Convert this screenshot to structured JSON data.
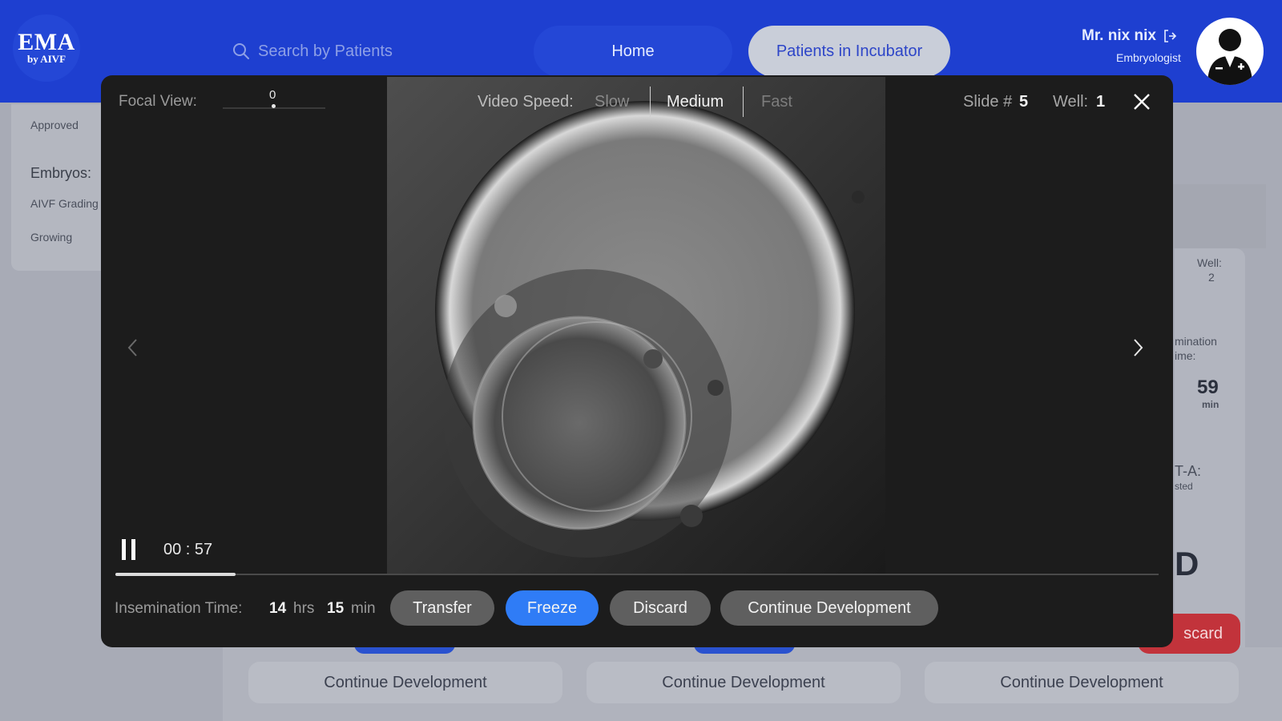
{
  "colors": {
    "header_bg": "#1e3fd0",
    "primary_blue": "#2f7cf6",
    "modal_bg": "#1c1c1c",
    "danger_red": "#c2333b"
  },
  "header": {
    "logo_main": "EMA",
    "logo_sub": "by AIVF",
    "search_placeholder": "Search by Patients",
    "search_icon": "search-icon",
    "nav_home": "Home",
    "nav_incubator": "Patients in Incubator",
    "user_name": "Mr. nix nix",
    "user_role": "Embryologist",
    "logout_icon": "logout-icon",
    "avatar_icon": "doctor-avatar-icon"
  },
  "background": {
    "sidebar": {
      "approved": "Approved",
      "embryos_label": "Embryos:",
      "aivf_grading": "AIVF Grading",
      "growing": "Growing"
    },
    "right_card": {
      "well_label": "Well:",
      "well_value": "2",
      "insemination_partial": "mination",
      "time_partial": "ime:",
      "minutes_value": "59",
      "minutes_unit": "min",
      "pgt_partial": "T-A:",
      "pgt_status_partial": "sted",
      "grade_partial": "D",
      "discard_partial": "scard"
    },
    "continue_buttons": [
      "Continue Development",
      "Continue Development",
      "Continue Development"
    ]
  },
  "modal": {
    "focal_view_label": "Focal View:",
    "focal_view_value": "0",
    "video_speed_label": "Video Speed:",
    "speed_options": [
      "Slow",
      "Medium",
      "Fast"
    ],
    "speed_selected": "Medium",
    "slide_label": "Slide #",
    "slide_value": "5",
    "well_label": "Well:",
    "well_value": "1",
    "close_icon": "close-icon",
    "prev_icon": "chevron-left-icon",
    "next_icon": "chevron-right-icon",
    "play_state_icon": "pause-icon",
    "time_display": "00 : 57",
    "progress_fraction": 0.115,
    "insemination_label": "Insemination Time:",
    "insemination_hours": "14",
    "insemination_hours_unit": "hrs",
    "insemination_minutes": "15",
    "insemination_minutes_unit": "min",
    "actions": {
      "transfer": "Transfer",
      "freeze": "Freeze",
      "discard": "Discard",
      "continue": "Continue Development"
    }
  }
}
